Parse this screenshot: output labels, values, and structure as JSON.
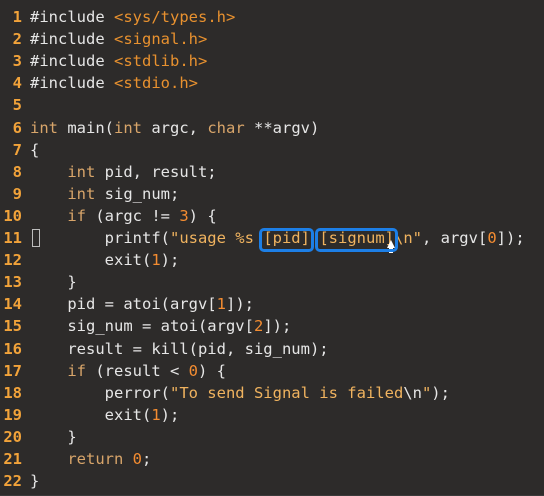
{
  "editor": {
    "lines": [
      {
        "num": "1",
        "code": [
          {
            "t": "#include ",
            "c": "pp"
          },
          {
            "t": "<sys/types.h>",
            "c": "inc"
          }
        ]
      },
      {
        "num": "2",
        "code": [
          {
            "t": "#include ",
            "c": "pp"
          },
          {
            "t": "<signal.h>",
            "c": "inc"
          }
        ]
      },
      {
        "num": "3",
        "code": [
          {
            "t": "#include ",
            "c": "pp"
          },
          {
            "t": "<stdlib.h>",
            "c": "inc"
          }
        ]
      },
      {
        "num": "4",
        "code": [
          {
            "t": "#include ",
            "c": "pp"
          },
          {
            "t": "<stdio.h>",
            "c": "inc"
          }
        ]
      },
      {
        "num": "5",
        "code": []
      },
      {
        "num": "6",
        "code": [
          {
            "t": "int",
            "c": "kw"
          },
          {
            "t": " main(",
            "c": "sym"
          },
          {
            "t": "int",
            "c": "kw"
          },
          {
            "t": " argc, ",
            "c": "sym"
          },
          {
            "t": "char",
            "c": "kw"
          },
          {
            "t": " **argv)",
            "c": "sym"
          }
        ]
      },
      {
        "num": "7",
        "code": [
          {
            "t": "{",
            "c": "sym"
          }
        ]
      },
      {
        "num": "8",
        "code": [
          {
            "t": "    ",
            "c": "sym"
          },
          {
            "t": "int",
            "c": "kw"
          },
          {
            "t": " pid, result;",
            "c": "sym"
          }
        ]
      },
      {
        "num": "9",
        "code": [
          {
            "t": "    ",
            "c": "sym"
          },
          {
            "t": "int",
            "c": "kw"
          },
          {
            "t": " sig_num;",
            "c": "sym"
          }
        ]
      },
      {
        "num": "10",
        "code": [
          {
            "t": "    ",
            "c": "sym"
          },
          {
            "t": "if",
            "c": "kw"
          },
          {
            "t": " (argc != ",
            "c": "sym"
          },
          {
            "t": "3",
            "c": "num"
          },
          {
            "t": ") {",
            "c": "sym"
          }
        ]
      },
      {
        "num": "11",
        "code": [
          {
            "t": "        printf(",
            "c": "sym"
          },
          {
            "t": "\"usage %s ",
            "c": "str"
          },
          {
            "t": "[pid]",
            "c": "str"
          },
          {
            "t": " ",
            "c": "str"
          },
          {
            "t": "[signum]",
            "c": "str"
          },
          {
            "t": "\\n\"",
            "c": "str"
          },
          {
            "t": ", argv[",
            "c": "sym"
          },
          {
            "t": "0",
            "c": "num"
          },
          {
            "t": "]);",
            "c": "sym"
          }
        ]
      },
      {
        "num": "12",
        "code": [
          {
            "t": "        exit(",
            "c": "sym"
          },
          {
            "t": "1",
            "c": "num"
          },
          {
            "t": ");",
            "c": "sym"
          }
        ]
      },
      {
        "num": "13",
        "code": [
          {
            "t": "    }",
            "c": "sym"
          }
        ]
      },
      {
        "num": "14",
        "code": [
          {
            "t": "    pid = atoi(argv[",
            "c": "sym"
          },
          {
            "t": "1",
            "c": "num"
          },
          {
            "t": "]);",
            "c": "sym"
          }
        ]
      },
      {
        "num": "15",
        "code": [
          {
            "t": "    sig_num = atoi(argv[",
            "c": "sym"
          },
          {
            "t": "2",
            "c": "num"
          },
          {
            "t": "]);",
            "c": "sym"
          }
        ]
      },
      {
        "num": "16",
        "code": [
          {
            "t": "    result = kill(pid, sig_num);",
            "c": "sym"
          }
        ]
      },
      {
        "num": "17",
        "code": [
          {
            "t": "    ",
            "c": "sym"
          },
          {
            "t": "if",
            "c": "kw"
          },
          {
            "t": " (result < ",
            "c": "sym"
          },
          {
            "t": "0",
            "c": "num"
          },
          {
            "t": ") {",
            "c": "sym"
          }
        ]
      },
      {
        "num": "18",
        "code": [
          {
            "t": "        perror(",
            "c": "sym"
          },
          {
            "t": "\"To send Signal is failed",
            "c": "str"
          },
          {
            "t": "\\n",
            "c": "sym"
          },
          {
            "t": "\"",
            "c": "str"
          },
          {
            "t": ");",
            "c": "sym"
          }
        ]
      },
      {
        "num": "19",
        "code": [
          {
            "t": "        exit(",
            "c": "sym"
          },
          {
            "t": "1",
            "c": "num"
          },
          {
            "t": ");",
            "c": "sym"
          }
        ]
      },
      {
        "num": "20",
        "code": [
          {
            "t": "    }",
            "c": "sym"
          }
        ]
      },
      {
        "num": "21",
        "code": [
          {
            "t": "    ",
            "c": "sym"
          },
          {
            "t": "return",
            "c": "kw"
          },
          {
            "t": " ",
            "c": "sym"
          },
          {
            "t": "0",
            "c": "num"
          },
          {
            "t": ";",
            "c": "sym"
          }
        ]
      },
      {
        "num": "22",
        "code": [
          {
            "t": "}",
            "c": "sym"
          }
        ]
      }
    ],
    "highlights": [
      {
        "text": "[pid]"
      },
      {
        "text": "[signum]"
      }
    ]
  },
  "colors": {
    "line_number": "#f2a33a",
    "keyword": "#d8a56a",
    "string": "#f0b35f",
    "number": "#f58d31",
    "highlight_box": "#1d7fe6",
    "background": "#2d2b2a"
  },
  "icons": [
    "mouse-pointer-icon",
    "text-caret-icon"
  ]
}
